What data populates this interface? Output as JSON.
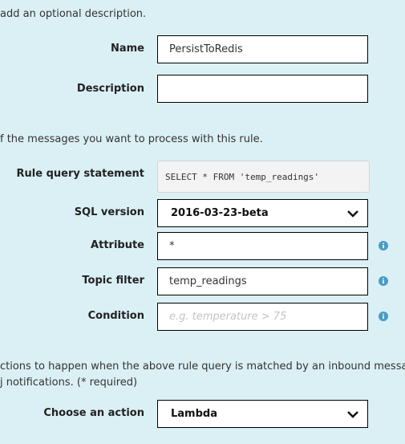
{
  "intro": {
    "add_description": "add an optional description.",
    "messages": "f the messages you want to process with this rule.",
    "actions_line1": "ctions to happen when the above rule query is matched by an inbound message",
    "actions_line2": "j notifications. (* required)"
  },
  "fields": {
    "name": {
      "label": "Name",
      "value": "PersistToRedis"
    },
    "description": {
      "label": "Description",
      "value": ""
    },
    "rule_query": {
      "label": "Rule query statement",
      "value": "SELECT * FROM 'temp_readings'"
    },
    "sql_version": {
      "label": "SQL version",
      "value": "2016-03-23-beta",
      "icon": "chevron-down-icon"
    },
    "attribute": {
      "label": "Attribute",
      "value": "*",
      "icon": "info-icon"
    },
    "topic_filter": {
      "label": "Topic filter",
      "value": "temp_readings",
      "icon": "info-icon"
    },
    "condition": {
      "label": "Condition",
      "value": "",
      "placeholder": "e.g. temperature > 75",
      "icon": "info-icon"
    },
    "action": {
      "label": "Choose an action",
      "value": "Lambda",
      "icon": "chevron-down-icon"
    }
  },
  "colors": {
    "background": "#dbf0f5",
    "info_icon": "#4a9cc7"
  }
}
